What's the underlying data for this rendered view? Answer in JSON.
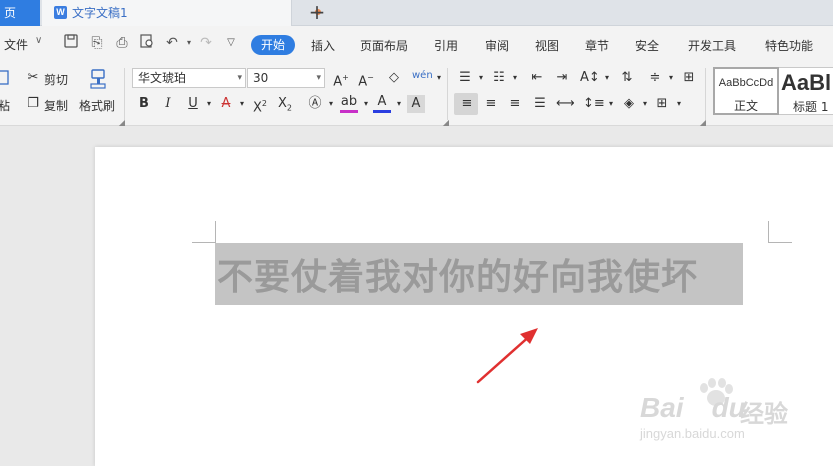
{
  "tabs": {
    "home_label": "页",
    "doc_label": "文字文稿1",
    "doc_icon_letter": "W",
    "add_label": "+"
  },
  "menu": {
    "file_label": "文件",
    "items": [
      "开始",
      "插入",
      "页面布局",
      "引用",
      "审阅",
      "视图",
      "章节",
      "安全",
      "开发工具",
      "特色功能"
    ],
    "active_index": 0
  },
  "toolbar": {
    "cut_label": "剪切",
    "copy_label": "复制",
    "paste_label": "粘",
    "format_painter_label": "格式刷",
    "font_name": "华文琥珀",
    "font_size": "30",
    "bold": "B",
    "italic": "I",
    "underline": "U",
    "style_normal_preview": "AaBbCcDd",
    "style_normal_label": "正文",
    "style_heading_preview": "AaBl",
    "style_heading_label": "标题 1"
  },
  "document": {
    "text": "不要仗着我对你的好向我使坏",
    "text_selected": true
  },
  "watermark": {
    "brand": "Bai",
    "brand_suffix": "du",
    "cn": "经验",
    "url": "jingyan.baidu.com"
  },
  "colors": {
    "accent": "#2f7de1",
    "tab_bg": "#dfe3e8",
    "ribbon_bg": "#f3f3f3",
    "selection": "#c4c4c4",
    "arrow": "#e03030",
    "font_color_underline": "#2a3ee0",
    "highlight_underline": "#c830c8"
  }
}
